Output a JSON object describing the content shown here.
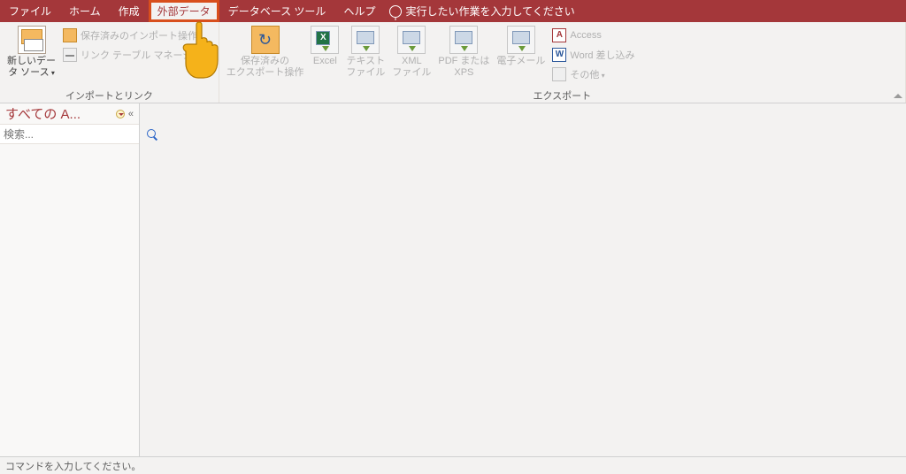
{
  "tabs": {
    "file": "ファイル",
    "home": "ホーム",
    "create": "作成",
    "external": "外部データ",
    "dbtools": "データベース ツール",
    "help": "ヘルプ"
  },
  "tellme": "実行したい作業を入力してください",
  "ribbon": {
    "group_import": "インポートとリンク",
    "group_export": "エクスポート",
    "new_source": {
      "l1": "新しいデー",
      "l2": "タ ソース"
    },
    "saved_imports": "保存済みのインポート操作",
    "link_manager": "リンク テーブル マネージャー",
    "saved_exports": {
      "l1": "保存済みの",
      "l2": "エクスポート操作"
    },
    "excel": "Excel",
    "text": {
      "l1": "テキスト",
      "l2": "ファイル"
    },
    "xml": {
      "l1": "XML",
      "l2": "ファイル"
    },
    "pdf": {
      "l1": "PDF または",
      "l2": "XPS"
    },
    "email": "電子メール",
    "export_access": "Access",
    "export_word": "Word 差し込み",
    "export_more": "その他"
  },
  "nav": {
    "title": "すべての A...",
    "search_placeholder": "検索...",
    "collapse": "«"
  },
  "status": "コマンドを入力してください。"
}
